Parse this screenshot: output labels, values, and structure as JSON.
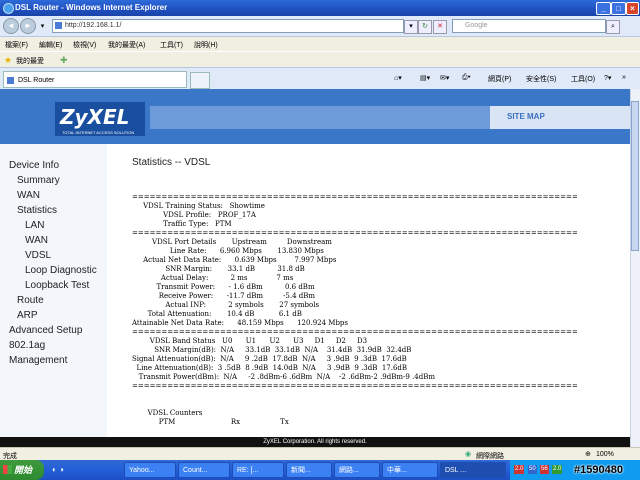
{
  "window": {
    "title": "DSL Router - Windows Internet Explorer"
  },
  "address_bar": {
    "url": "http://192.168.1.1/",
    "search_placeholder": "Google"
  },
  "menu": [
    "檔案(F)",
    "編輯(E)",
    "檢視(V)",
    "我的最愛(A)",
    "工具(T)",
    "說明(H)"
  ],
  "favorites": {
    "label": "我的最愛"
  },
  "tab": {
    "title": "DSL Router"
  },
  "command_bar": {
    "page": "網頁(P)",
    "safety": "安全性(S)",
    "tools": "工具(O)"
  },
  "header": {
    "logo": "ZyXEL",
    "tagline": "TOTAL INTERNET ACCESS SOLUTION",
    "site_map": "SITE MAP"
  },
  "sidebar": {
    "items": [
      {
        "label": "Device Info"
      },
      {
        "label": "Summary"
      },
      {
        "label": "WAN"
      },
      {
        "label": "Statistics"
      },
      {
        "label": "LAN"
      },
      {
        "label": "WAN"
      },
      {
        "label": "VDSL"
      },
      {
        "label": "Loop Diagnostic"
      },
      {
        "label": "Loopback Test"
      },
      {
        "label": "Route"
      },
      {
        "label": "ARP"
      },
      {
        "label": "Advanced Setup"
      },
      {
        "label": "802.1ag"
      },
      {
        "label": "Management"
      }
    ]
  },
  "main": {
    "title": "Statistics -- VDSL",
    "stats_text": "============================================================================\n     VDSL Training Status:   Showtime\n              VDSL Profile:   PROF_17A\n              Traffic Type:   PTM\n============================================================================\n         VDSL Port Details       Upstream         Downstream\n                 Line Rate:      6.960 Mbps       13.830 Mbps\n     Actual Net Data Rate:      0.639 Mbps        7.997 Mbps\n               SNR Margin:       33.1 dB          31.8 dB\n             Actual Delay:          2 ms             7 ms\n           Transmit Power:      - 1.6 dBm          0.6 dBm\n            Receive Power:      -11.7 dBm         -5.4 dBm\n               Actual INP:          2 symbols       27 symbols\n       Total Attenuation:       10.4 dB           6.1 dB\nAttainable Net Data Rate:      48.159 Mbps      120.924 Mbps\n============================================================================\n        VDSL Band Status   U0      U1      U2      U3     D1     D2     D3\n          SNR Margin(dB):  N/A     33.1dB  33.1dB  N/A    31.4dB  31.9dB  32.4dB\nSignal Attenuation(dB):  N/A     9 .2dB  17.8dB  N/A     3 .9dB  9 .3dB  17.6dB\n  Line Attenuation(dB):  3 .5dB  8 .9dB  14.0dB  N/A     3 .9dB  9 .3dB  17.6dB\n   Transmit Power(dBm):  N/A     -2 .8dBm-6 .6dBm  N/A    -2 .6dBm-2 .9dBm-9 .4dBm\n============================================================================\n\n\n       VDSL Counters\n            PTM                         Rx                  Tx",
    "footer": "ZyXEL Corporation. All rights reserved."
  },
  "status_bar": {
    "left": "完成",
    "zone": "網際網路",
    "zoom": "100%"
  },
  "taskbar": {
    "start": "開始",
    "buttons": [
      "Yahoo...",
      "Count...",
      "RE: [...",
      "新聞...",
      "網路...",
      "中華...",
      "DSL ..."
    ],
    "tray": [
      "2.0",
      "50",
      "56",
      "2.0"
    ]
  },
  "watermark": "#1590480"
}
